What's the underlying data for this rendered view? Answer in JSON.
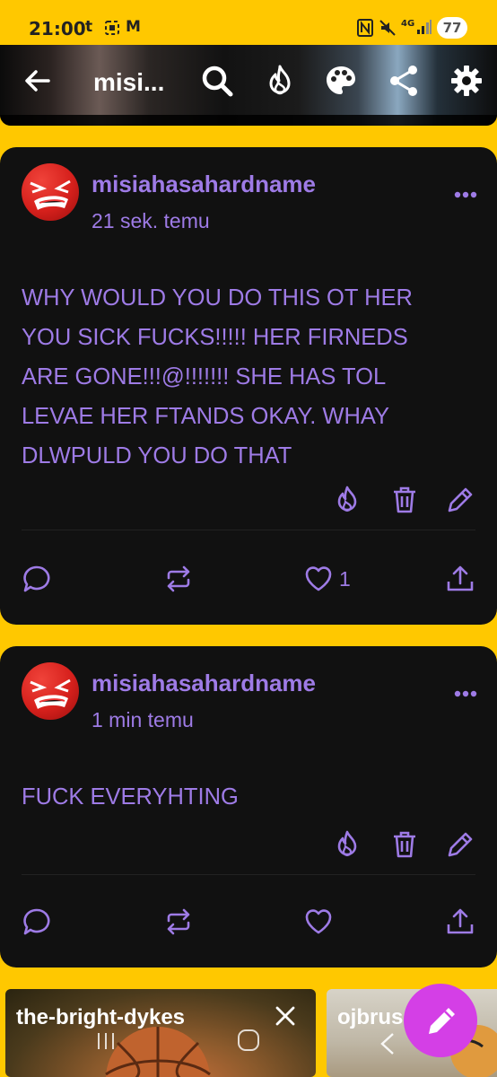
{
  "status_bar": {
    "time": "21:00",
    "notif_t": "t",
    "notif_m": "M",
    "network": "4G",
    "battery": "77"
  },
  "app_bar": {
    "title": "misi...",
    "icons": [
      "back-arrow-icon",
      "search-icon",
      "flame-icon",
      "palette-icon",
      "share-icon",
      "gear-icon"
    ]
  },
  "posts": [
    {
      "username": "misiahasahardname",
      "timestamp": "21 sek. temu",
      "lines": [
        "WHY WOULD YOU DO THIS OT HER",
        "YOU SICK FUCKS!!!!! HER FIRNEDS",
        "ARE GONE!!!@!!!!!!! SHE HAS TOL",
        "LEVAE HER FTANDS OKAY. WHAY",
        "DLWPULD YOU DO THAT"
      ],
      "like_count": "1"
    },
    {
      "username": "misiahasahardname",
      "timestamp": "1 min temu",
      "lines": [
        "FUCK EVERYHTING"
      ],
      "like_count": ""
    }
  ],
  "tabs": [
    {
      "label": "the-bright-dykes"
    },
    {
      "label": "ojbrus"
    }
  ],
  "colors": {
    "background": "#FFC800",
    "card": "#111111",
    "accent": "#9E7BE6",
    "fab": "#D43FE6"
  }
}
